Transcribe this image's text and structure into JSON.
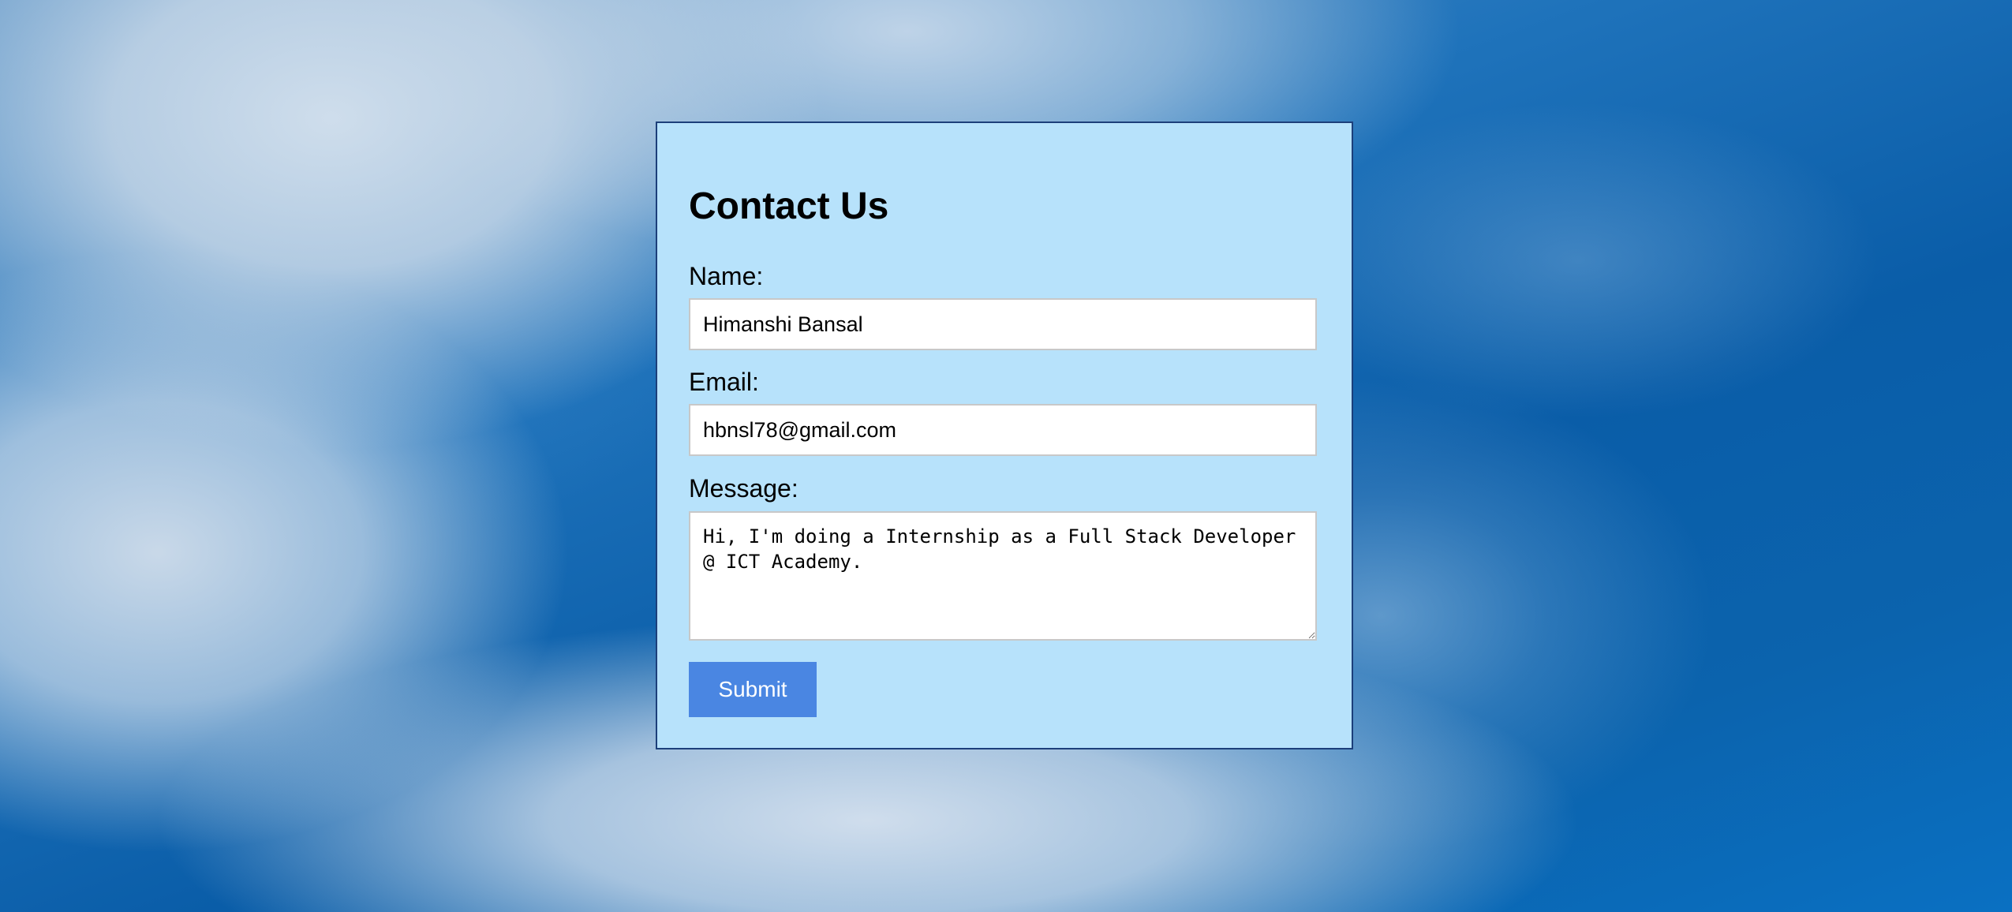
{
  "form": {
    "title": "Contact Us",
    "name_label": "Name:",
    "name_value": "Himanshi Bansal",
    "email_label": "Email:",
    "email_value": "hbnsl78@gmail.com",
    "message_label": "Message:",
    "message_value": "Hi, I'm doing a Internship as a Full Stack Developer @ ICT Academy.",
    "submit_label": "Submit"
  },
  "colors": {
    "card_background": "#b7e2fb",
    "card_border": "#1c3f7a",
    "submit_background": "#4a86e2",
    "submit_text": "#ffffff"
  }
}
